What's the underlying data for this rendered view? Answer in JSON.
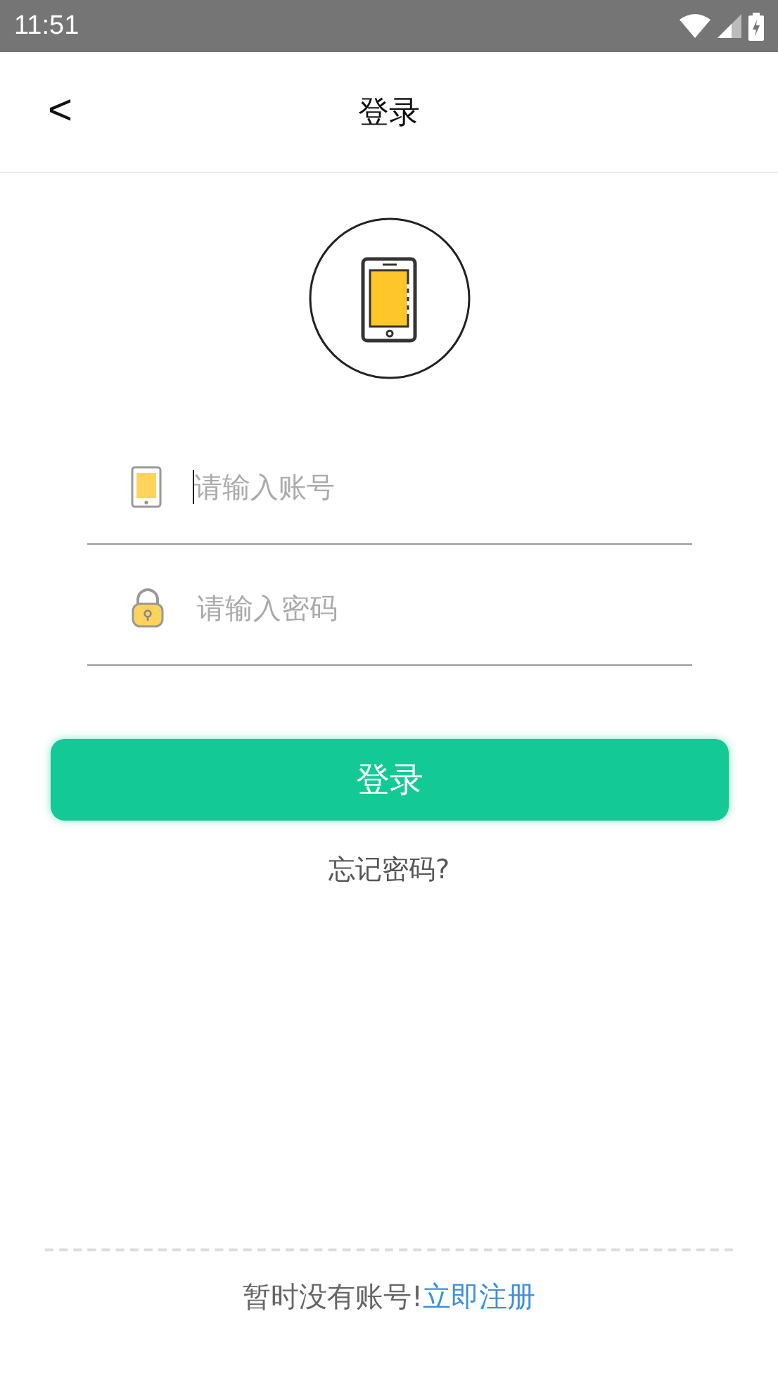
{
  "status_bar": {
    "time": "11:51"
  },
  "header": {
    "back": "<",
    "title": "登录"
  },
  "fields": [
    {
      "kind": "account",
      "placeholder": "请输入账号",
      "focused": true
    },
    {
      "kind": "password",
      "placeholder": "请输入密码",
      "focused": false
    }
  ],
  "login_button": "登录",
  "forgot_link": "忘记密码?",
  "footer": {
    "text": "暂时没有账号!",
    "link": "立即注册"
  }
}
